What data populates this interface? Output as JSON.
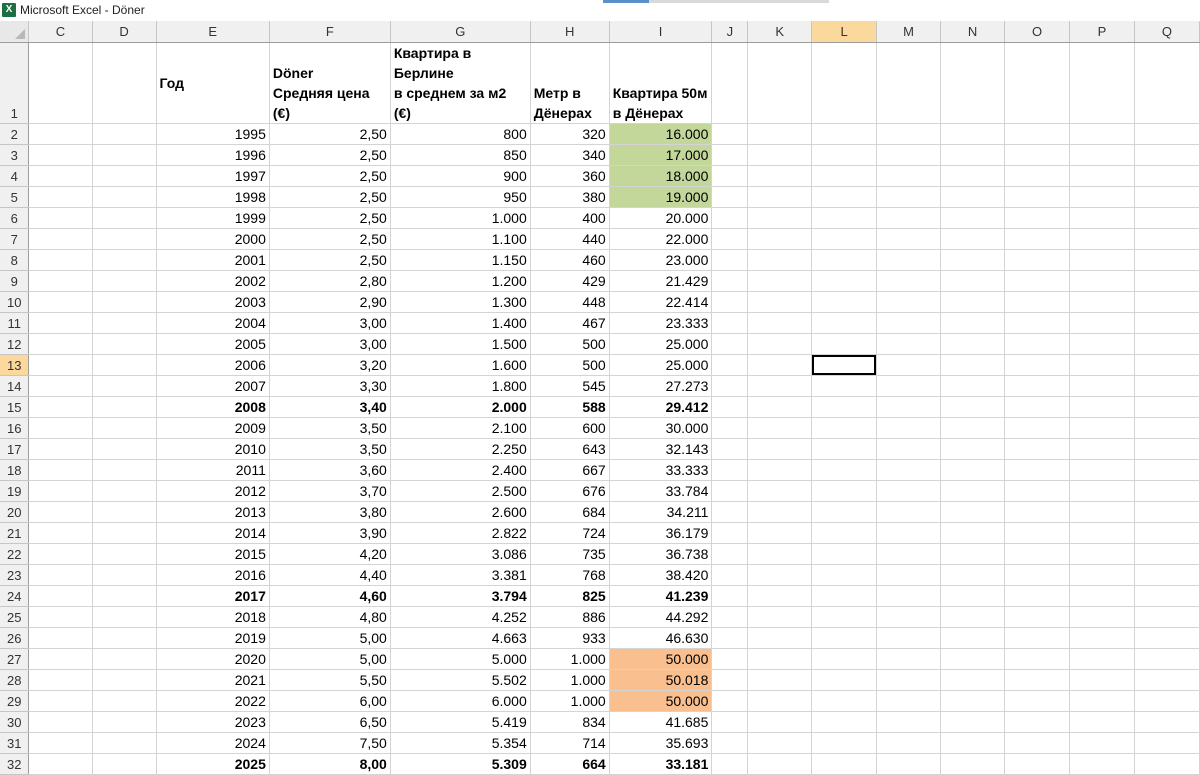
{
  "window": {
    "title": "Microsoft Excel - Döner",
    "app_icon": "excel-icon"
  },
  "columns": [
    "C",
    "D",
    "E",
    "F",
    "G",
    "H",
    "I",
    "J",
    "K",
    "L",
    "M",
    "N",
    "O",
    "P",
    "Q"
  ],
  "selected_column": "L",
  "selected_row": 13,
  "header_row": {
    "row": 1,
    "year": "Год",
    "doner_price_line1": "Döner",
    "doner_price_line2": "Средняя цена (€)",
    "apt_price_line1": "Квартира в Берлине",
    "apt_price_line2": "в среднем за м2 (€)",
    "meter_line1": "Метр в",
    "meter_line2": "Дёнерах",
    "apt50_line1": "Квартира 50м",
    "apt50_line2": "в Дёнерах"
  },
  "highlight_colors": {
    "green": "#c4d79b",
    "orange": "#fabf8f",
    "selection": "#fbd89c"
  },
  "rows": [
    {
      "row": 2,
      "year": "1995",
      "doner": "2,50",
      "apt": "800",
      "meter": "320",
      "apt50": "16.000",
      "hl": "green"
    },
    {
      "row": 3,
      "year": "1996",
      "doner": "2,50",
      "apt": "850",
      "meter": "340",
      "apt50": "17.000",
      "hl": "green"
    },
    {
      "row": 4,
      "year": "1997",
      "doner": "2,50",
      "apt": "900",
      "meter": "360",
      "apt50": "18.000",
      "hl": "green"
    },
    {
      "row": 5,
      "year": "1998",
      "doner": "2,50",
      "apt": "950",
      "meter": "380",
      "apt50": "19.000",
      "hl": "green"
    },
    {
      "row": 6,
      "year": "1999",
      "doner": "2,50",
      "apt": "1.000",
      "meter": "400",
      "apt50": "20.000"
    },
    {
      "row": 7,
      "year": "2000",
      "doner": "2,50",
      "apt": "1.100",
      "meter": "440",
      "apt50": "22.000"
    },
    {
      "row": 8,
      "year": "2001",
      "doner": "2,50",
      "apt": "1.150",
      "meter": "460",
      "apt50": "23.000"
    },
    {
      "row": 9,
      "year": "2002",
      "doner": "2,80",
      "apt": "1.200",
      "meter": "429",
      "apt50": "21.429"
    },
    {
      "row": 10,
      "year": "2003",
      "doner": "2,90",
      "apt": "1.300",
      "meter": "448",
      "apt50": "22.414"
    },
    {
      "row": 11,
      "year": "2004",
      "doner": "3,00",
      "apt": "1.400",
      "meter": "467",
      "apt50": "23.333"
    },
    {
      "row": 12,
      "year": "2005",
      "doner": "3,00",
      "apt": "1.500",
      "meter": "500",
      "apt50": "25.000"
    },
    {
      "row": 13,
      "year": "2006",
      "doner": "3,20",
      "apt": "1.600",
      "meter": "500",
      "apt50": "25.000"
    },
    {
      "row": 14,
      "year": "2007",
      "doner": "3,30",
      "apt": "1.800",
      "meter": "545",
      "apt50": "27.273"
    },
    {
      "row": 15,
      "year": "2008",
      "doner": "3,40",
      "apt": "2.000",
      "meter": "588",
      "apt50": "29.412",
      "bold": true
    },
    {
      "row": 16,
      "year": "2009",
      "doner": "3,50",
      "apt": "2.100",
      "meter": "600",
      "apt50": "30.000"
    },
    {
      "row": 17,
      "year": "2010",
      "doner": "3,50",
      "apt": "2.250",
      "meter": "643",
      "apt50": "32.143"
    },
    {
      "row": 18,
      "year": "2011",
      "doner": "3,60",
      "apt": "2.400",
      "meter": "667",
      "apt50": "33.333"
    },
    {
      "row": 19,
      "year": "2012",
      "doner": "3,70",
      "apt": "2.500",
      "meter": "676",
      "apt50": "33.784"
    },
    {
      "row": 20,
      "year": "2013",
      "doner": "3,80",
      "apt": "2.600",
      "meter": "684",
      "apt50": "34.211"
    },
    {
      "row": 21,
      "year": "2014",
      "doner": "3,90",
      "apt": "2.822",
      "meter": "724",
      "apt50": "36.179"
    },
    {
      "row": 22,
      "year": "2015",
      "doner": "4,20",
      "apt": "3.086",
      "meter": "735",
      "apt50": "36.738"
    },
    {
      "row": 23,
      "year": "2016",
      "doner": "4,40",
      "apt": "3.381",
      "meter": "768",
      "apt50": "38.420"
    },
    {
      "row": 24,
      "year": "2017",
      "doner": "4,60",
      "apt": "3.794",
      "meter": "825",
      "apt50": "41.239",
      "bold": true
    },
    {
      "row": 25,
      "year": "2018",
      "doner": "4,80",
      "apt": "4.252",
      "meter": "886",
      "apt50": "44.292"
    },
    {
      "row": 26,
      "year": "2019",
      "doner": "5,00",
      "apt": "4.663",
      "meter": "933",
      "apt50": "46.630"
    },
    {
      "row": 27,
      "year": "2020",
      "doner": "5,00",
      "apt": "5.000",
      "meter": "1.000",
      "apt50": "50.000",
      "hl": "orange"
    },
    {
      "row": 28,
      "year": "2021",
      "doner": "5,50",
      "apt": "5.502",
      "meter": "1.000",
      "apt50": "50.018",
      "hl": "orange"
    },
    {
      "row": 29,
      "year": "2022",
      "doner": "6,00",
      "apt": "6.000",
      "meter": "1.000",
      "apt50": "50.000",
      "hl": "orange"
    },
    {
      "row": 30,
      "year": "2023",
      "doner": "6,50",
      "apt": "5.419",
      "meter": "834",
      "apt50": "41.685"
    },
    {
      "row": 31,
      "year": "2024",
      "doner": "7,50",
      "apt": "5.354",
      "meter": "714",
      "apt50": "35.693"
    },
    {
      "row": 32,
      "year": "2025",
      "doner": "8,00",
      "apt": "5.309",
      "meter": "664",
      "apt50": "33.181",
      "bold": true
    }
  ]
}
